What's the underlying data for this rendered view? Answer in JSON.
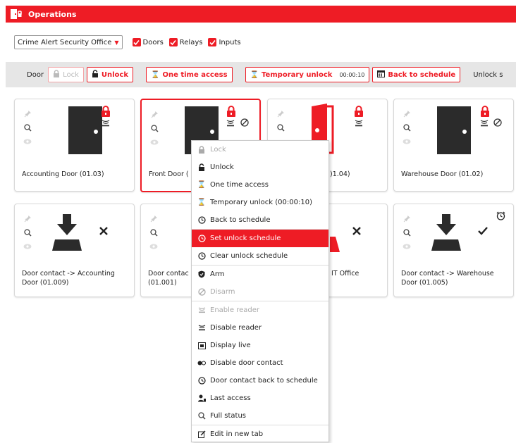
{
  "app": {
    "title": "Operations"
  },
  "filters": {
    "site": "Crime Alert Security Office",
    "checks": [
      {
        "label": "Doors",
        "checked": true
      },
      {
        "label": "Relays",
        "checked": true
      },
      {
        "label": "Inputs",
        "checked": true
      }
    ]
  },
  "toolbar": {
    "door_label": "Door",
    "lock": "Lock",
    "unlock": "Unlock",
    "one_time": "One time access",
    "temp_unlock": "Temporary unlock",
    "temp_time": "00:00:10",
    "back_schedule": "Back to schedule",
    "unlock_label": "Unlock s"
  },
  "cards": [
    {
      "name": "Accounting Door (01.03)"
    },
    {
      "name": "Front Door ("
    },
    {
      "name": ")1.04)"
    },
    {
      "name": "Warehouse Door (01.02)"
    },
    {
      "name": "Door contact -> Accounting Door (01.009)"
    },
    {
      "name": "Door contac (01.001)"
    },
    {
      "name": "IT Office"
    },
    {
      "name": "Door contact -> Warehouse Door (01.005)"
    }
  ],
  "menu": {
    "items": [
      {
        "label": "Lock"
      },
      {
        "label": "Unlock"
      },
      {
        "label": "One time access"
      },
      {
        "label": "Temporary unlock (00:00:10)"
      },
      {
        "label": "Back to schedule"
      },
      {
        "label": "Set unlock schedule"
      },
      {
        "label": "Clear unlock schedule"
      },
      {
        "label": "Arm"
      },
      {
        "label": "Disarm"
      },
      {
        "label": "Enable reader"
      },
      {
        "label": "Disable reader"
      },
      {
        "label": "Display live"
      },
      {
        "label": "Disable door contact"
      },
      {
        "label": "Door contact back to schedule"
      },
      {
        "label": "Last access"
      },
      {
        "label": "Full status"
      },
      {
        "label": "Edit in new tab"
      }
    ]
  },
  "colors": {
    "accent": "#ee1c25",
    "dark": "#2b2b2b"
  }
}
